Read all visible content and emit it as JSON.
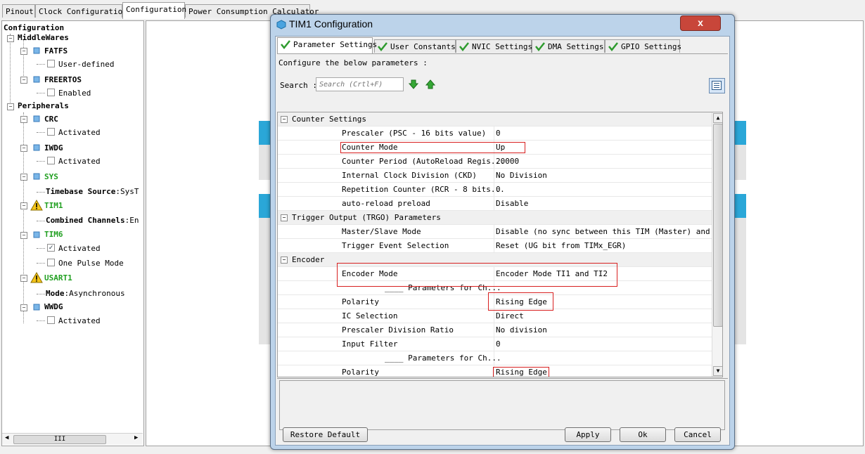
{
  "main_tabs": [
    "Pinout",
    "Clock Configuration",
    "Configuration",
    "Power Consumption Calculator"
  ],
  "tree": {
    "root": "Configuration",
    "middlewares": "MiddleWares",
    "fatfs": "FATFS",
    "fatfs_opt": "User-defined",
    "freertos": "FREERTOS",
    "freertos_opt": "Enabled",
    "peripherals": "Peripherals",
    "crc": "CRC",
    "crc_opt": "Activated",
    "iwdg": "IWDG",
    "iwdg_opt": "Activated",
    "sys": "SYS",
    "sys_opt_label": "Timebase Source",
    "sys_opt_value": ":SysT",
    "tim1": "TIM1",
    "tim1_opt_label": "Combined Channels",
    "tim1_opt_value": ":En",
    "tim6": "TIM6",
    "tim6_opt1": "Activated",
    "tim6_opt2": "One Pulse Mode",
    "usart1": "USART1",
    "usart1_opt_label": "Mode",
    "usart1_opt_value": ":Asynchronous",
    "wwdg": "WWDG",
    "wwdg_opt": "Activated",
    "scroll_grip": "III"
  },
  "dialog": {
    "title": "TIM1 Configuration",
    "close": "x",
    "tabs": [
      "Parameter Settings",
      "User Constants",
      "NVIC Settings",
      "DMA Settings",
      "GPIO Settings"
    ],
    "instruction": "Configure the below parameters :",
    "search_label": "Search :",
    "search_placeholder": "Search (Crtl+F)",
    "rows": [
      {
        "type": "cat",
        "name": "Counter Settings"
      },
      {
        "type": "param",
        "name": "Prescaler (PSC - 16 bits value)",
        "value": "0"
      },
      {
        "type": "param",
        "name": "Counter Mode",
        "value": "Up"
      },
      {
        "type": "param",
        "name": "Counter Period (AutoReload Regis...",
        "value": "20000"
      },
      {
        "type": "param",
        "name": "Internal Clock Division (CKD)",
        "value": "No Division"
      },
      {
        "type": "param",
        "name": "Repetition Counter (RCR - 8 bits...",
        "value": "0"
      },
      {
        "type": "param",
        "name": "auto-reload preload",
        "value": "Disable"
      },
      {
        "type": "cat",
        "name": "Trigger Output (TRGO) Parameters"
      },
      {
        "type": "param",
        "name": "Master/Slave Mode",
        "value": "Disable (no sync between this TIM (Master) and ..."
      },
      {
        "type": "param",
        "name": "Trigger Event Selection",
        "value": "Reset (UG bit from TIMx_EGR)"
      },
      {
        "type": "cat",
        "name": "Encoder"
      },
      {
        "type": "param",
        "name": "Encoder Mode",
        "value": "Encoder Mode TI1 and TI2"
      },
      {
        "type": "sub",
        "name": "____ Parameters for Ch...",
        "value": ""
      },
      {
        "type": "param",
        "name": "Polarity",
        "value": "Rising Edge"
      },
      {
        "type": "param",
        "name": "IC Selection",
        "value": "Direct"
      },
      {
        "type": "param",
        "name": "Prescaler Division Ratio",
        "value": "No division"
      },
      {
        "type": "param",
        "name": "Input Filter",
        "value": "0"
      },
      {
        "type": "sub",
        "name": "____ Parameters for Ch...",
        "value": ""
      },
      {
        "type": "param",
        "name": "Polarity",
        "value": "Rising Edge"
      }
    ],
    "buttons": {
      "restore": "Restore Default",
      "apply": "Apply",
      "ok": "Ok",
      "cancel": "Cancel"
    }
  },
  "colors": {
    "highlight": "#d82020",
    "accent_green": "#22a022",
    "dialog_frame": "#bcd3ea"
  }
}
